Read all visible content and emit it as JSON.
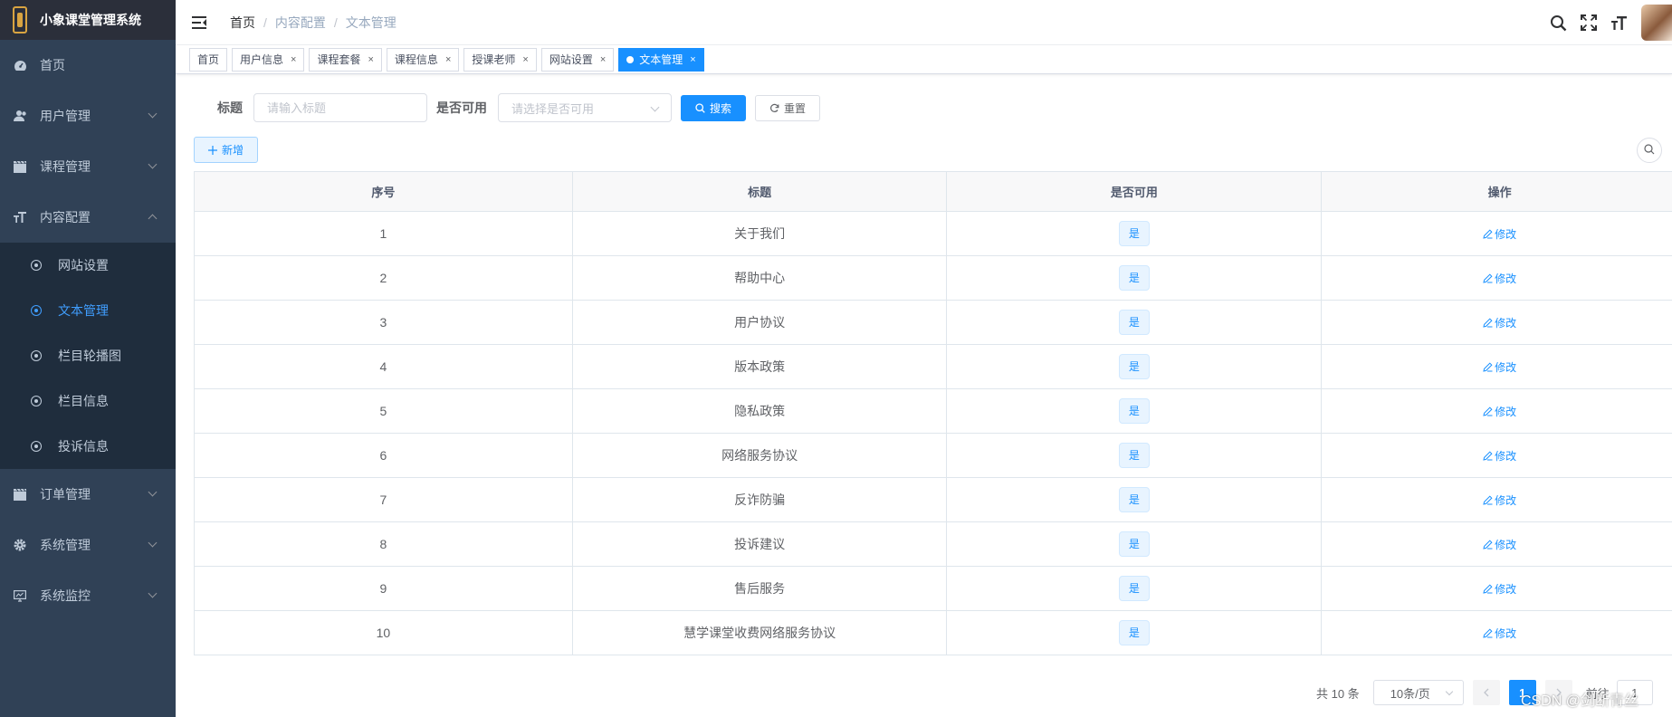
{
  "app": {
    "title": "小象课堂管理系统"
  },
  "sidebar": {
    "items": [
      {
        "label": "首页",
        "icon": "dashboard-icon"
      },
      {
        "label": "用户管理",
        "icon": "user-icon"
      },
      {
        "label": "课程管理",
        "icon": "clapperboard-icon"
      },
      {
        "label": "内容配置",
        "icon": "text-size-icon"
      },
      {
        "label": "订单管理",
        "icon": "clapperboard-icon"
      },
      {
        "label": "系统管理",
        "icon": "gear-icon"
      },
      {
        "label": "系统监控",
        "icon": "monitor-icon"
      }
    ],
    "sub_items": [
      {
        "label": "网站设置"
      },
      {
        "label": "文本管理",
        "active": true
      },
      {
        "label": "栏目轮播图"
      },
      {
        "label": "栏目信息"
      },
      {
        "label": "投诉信息"
      }
    ]
  },
  "breadcrumb": [
    "首页",
    "内容配置",
    "文本管理"
  ],
  "tags": [
    {
      "label": "首页"
    },
    {
      "label": "用户信息"
    },
    {
      "label": "课程套餐"
    },
    {
      "label": "课程信息"
    },
    {
      "label": "授课老师"
    },
    {
      "label": "网站设置"
    },
    {
      "label": "文本管理",
      "active": true
    }
  ],
  "search": {
    "title_label": "标题",
    "title_placeholder": "请输入标题",
    "available_label": "是否可用",
    "available_placeholder": "请选择是否可用",
    "search_button": "搜索",
    "reset_button": "重置",
    "add_button": "新增"
  },
  "table": {
    "columns": [
      "序号",
      "标题",
      "是否可用",
      "操作"
    ],
    "rows": [
      {
        "index": "1",
        "title": "关于我们",
        "available": "是",
        "action": "修改"
      },
      {
        "index": "2",
        "title": "帮助中心",
        "available": "是",
        "action": "修改"
      },
      {
        "index": "3",
        "title": "用户协议",
        "available": "是",
        "action": "修改"
      },
      {
        "index": "4",
        "title": "版本政策",
        "available": "是",
        "action": "修改"
      },
      {
        "index": "5",
        "title": "隐私政策",
        "available": "是",
        "action": "修改"
      },
      {
        "index": "6",
        "title": "网络服务协议",
        "available": "是",
        "action": "修改"
      },
      {
        "index": "7",
        "title": "反诈防骗",
        "available": "是",
        "action": "修改"
      },
      {
        "index": "8",
        "title": "投诉建议",
        "available": "是",
        "action": "修改"
      },
      {
        "index": "9",
        "title": "售后服务",
        "available": "是",
        "action": "修改"
      },
      {
        "index": "10",
        "title": "慧学课堂收费网络服务协议",
        "available": "是",
        "action": "修改"
      }
    ]
  },
  "pagination": {
    "total": "共 10 条",
    "page_size": "10条/页",
    "current_page": "1",
    "goto_label": "前往",
    "goto_value": "1"
  },
  "watermark": "CSDN @剑断青丝"
}
